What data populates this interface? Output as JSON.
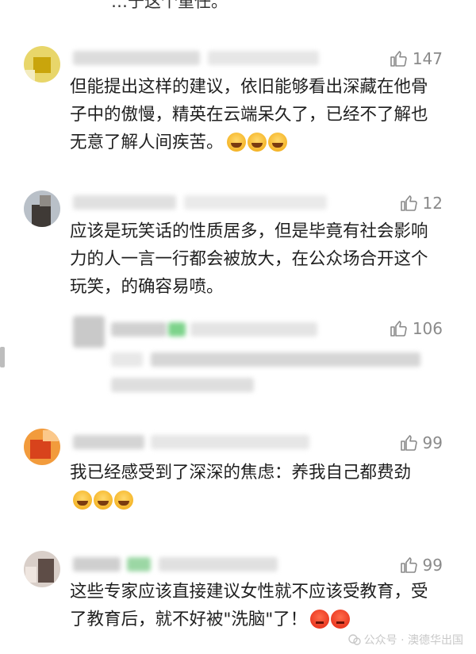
{
  "clipped_text": "…于这个重任。",
  "comments": [
    {
      "likes": "147",
      "text": "但能提出这样的建议，依旧能够看出深藏在他骨子中的傲慢，精英在云端呆久了，已经不了解也无意了解人间疾苦。",
      "emoji": [
        "laugh-cry-emoji",
        "laugh-cry-emoji",
        "laugh-cry-emoji"
      ]
    },
    {
      "likes": "12",
      "text": "应该是玩笑话的性质居多，但是毕竟有社会影响力的人一言一行都会被放大，在公众场合开这个玩笑，的确容易喷。"
    },
    {
      "likes": "106",
      "blurred": true
    },
    {
      "likes": "99",
      "text": "我已经感受到了深深的焦虑：养我自己都费劲",
      "emoji": [
        "laugh-cry-emoji",
        "laugh-cry-emoji",
        "laugh-cry-emoji"
      ]
    },
    {
      "likes": "99",
      "text": "这些专家应该直接建议女性就不应该受教育，受了教育后，就不好被\"洗脑\"了！",
      "emoji": [
        "angry-emoji",
        "angry-emoji"
      ]
    }
  ],
  "watermark": "公众号 · 澳德华出国",
  "colors": {
    "like_gray": "#8a8a8a",
    "text": "#1f1f1f"
  }
}
